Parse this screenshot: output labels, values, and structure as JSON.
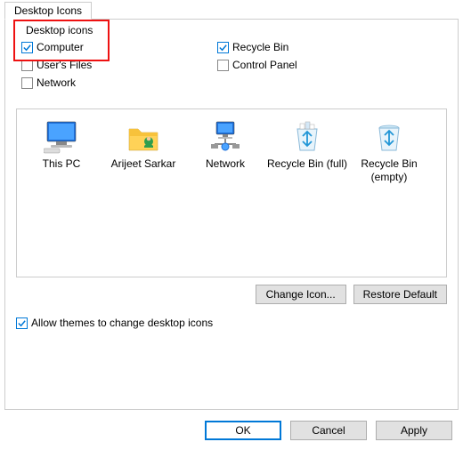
{
  "tab": {
    "label": "Desktop Icons"
  },
  "group": {
    "title": "Desktop icons"
  },
  "checks": {
    "computer": {
      "label": "Computer",
      "checked": true
    },
    "recycle": {
      "label": "Recycle Bin",
      "checked": true
    },
    "userfiles": {
      "label": "User's Files",
      "checked": false
    },
    "control": {
      "label": "Control Panel",
      "checked": false
    },
    "network": {
      "label": "Network",
      "checked": false
    }
  },
  "icons": {
    "thispc": "This PC",
    "user": "Arijeet Sarkar",
    "network": "Network",
    "binfull": "Recycle Bin (full)",
    "binempty": "Recycle Bin (empty)"
  },
  "buttons": {
    "changeicon": "Change Icon...",
    "restore": "Restore Default",
    "ok": "OK",
    "cancel": "Cancel",
    "apply": "Apply"
  },
  "themes": {
    "label": "Allow themes to change desktop icons",
    "checked": true
  }
}
